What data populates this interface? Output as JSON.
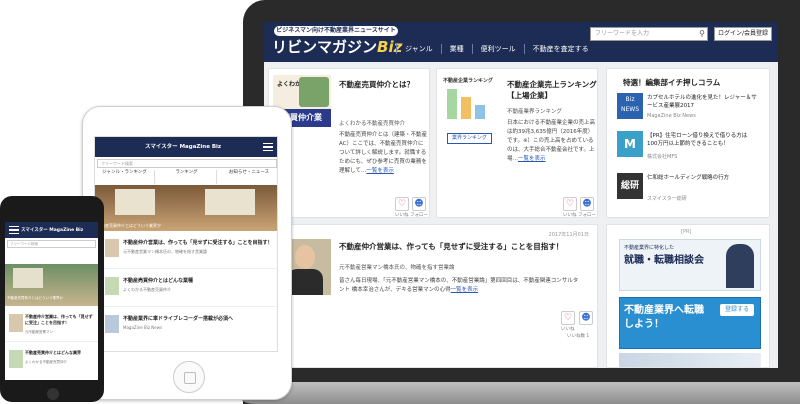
{
  "site": {
    "tagline": "ビジネスマン向け不動産業界ニュースサイト",
    "logo_main": "リビンマガジン",
    "logo_accent": "Biz",
    "nav": [
      "ジャンル",
      "業種",
      "便利ツール",
      "不動産を査定する"
    ],
    "search_placeholder": "フリーワードを入力",
    "login_label": "ログイン/会員登録"
  },
  "cards": [
    {
      "title": "不動産売買仲介とは？",
      "thumb_text": "売買仲介業",
      "thumb_top": "よくわかる",
      "sub": "よくわかる不動産売買仲介",
      "body": "不動産売買仲介とは（建築・不動産AC）ここでは、不動産売買仲介について詳しく解説します。就職するためにも、ぜひ参考に売買の業務を理解して…",
      "more": "一覧を表示",
      "like": "いいね",
      "follow": "フォロー"
    },
    {
      "title": "不動産企業売上ランキング【上場企業】",
      "thumb_text": "不動産企業ランキング",
      "sub": "不動産業界ランキング",
      "tag": "業界ランキング",
      "body": "日本における不動産業企業の売上高は約39兆3,635億円（2016年度）です。※）この売上高を占めているのは、大手総合不動産会社です。上場…",
      "more": "一覧を表示",
      "like": "いいね",
      "follow": "フォロー"
    }
  ],
  "feature": {
    "title": "不動産仲介営業は、作っても「見せずに受注する」ことを目指す！",
    "date": "2017年11月01日",
    "sub": "元不動産営業マン橋本氏の、物確を指す営業論",
    "body": "皆さん毎日現場、「元不動産営業マン橋本の、不動産営業論」第四回目は、不動産関連コンサルタント 橋本幸治さんが、デキる営業マンの心得",
    "more": "一覧を表示",
    "like": "いいね",
    "count": "いいね数 1"
  },
  "sidebar": {
    "heading": "特選！編集部イチ押しコラム",
    "items": [
      {
        "icon_text": "Biz NEWS",
        "title": "カプセルホテルの進化を見た！レジャー＆サービス産業展2017",
        "meta": "MagaZine Biz News"
      },
      {
        "icon_text": "M",
        "title": "【PR】住宅ローン借り換えで借りる方は 100万円以上節約できることも！",
        "meta": "株式会社MFS"
      },
      {
        "icon_text": "総研",
        "title": "仁和総ホールディング戦略の行方",
        "meta": "スマイスター総研"
      }
    ],
    "pr_label": "[PR]",
    "banner1_small": "不動産業界に特化した",
    "banner1_big": "就職・転職相談会",
    "banner2_title": "不動産業界へ転職しよう！",
    "banner2_btn": "登録する"
  },
  "tablet": {
    "logo": "スマイスター MagaZine Biz",
    "search": "フリーワード検索",
    "tabs": [
      "ジャンル・ランキング",
      "ランキング",
      "お知らせ・ニュース"
    ],
    "hero_caption": "不動産売買仲介とはどういう業界か",
    "items": [
      {
        "title": "不動産仲介営業は、作っても「見せずに受注する」ことを目指す！",
        "sub": "元不動産営業マン橋本氏の、物確を指す営業論"
      },
      {
        "title": "不動産売買仲介とはどんな業種",
        "sub": "よくわかる不動産売買仲介"
      },
      {
        "title": "不動産業界に車ドライブレコーダー搭載が必須へ",
        "sub": "MagaZine Biz News"
      }
    ]
  },
  "phone": {
    "logo": "スマイスター MagaZine Biz",
    "search": "フリーワード検索",
    "hero_caption": "不動産売買仲介とはどういう業界か",
    "items": [
      {
        "title": "不動産仲介営業は、作っても「見せずに受注」ことを目指す！",
        "sub": "元不動産営業マン"
      },
      {
        "title": "不動産売買仲介とはどんな業界",
        "sub": "よくわかる不動産売買仲介"
      }
    ]
  },
  "colors": {
    "header": "#1d2c55",
    "accent": "#f5d24a",
    "link": "#2a57b0"
  }
}
